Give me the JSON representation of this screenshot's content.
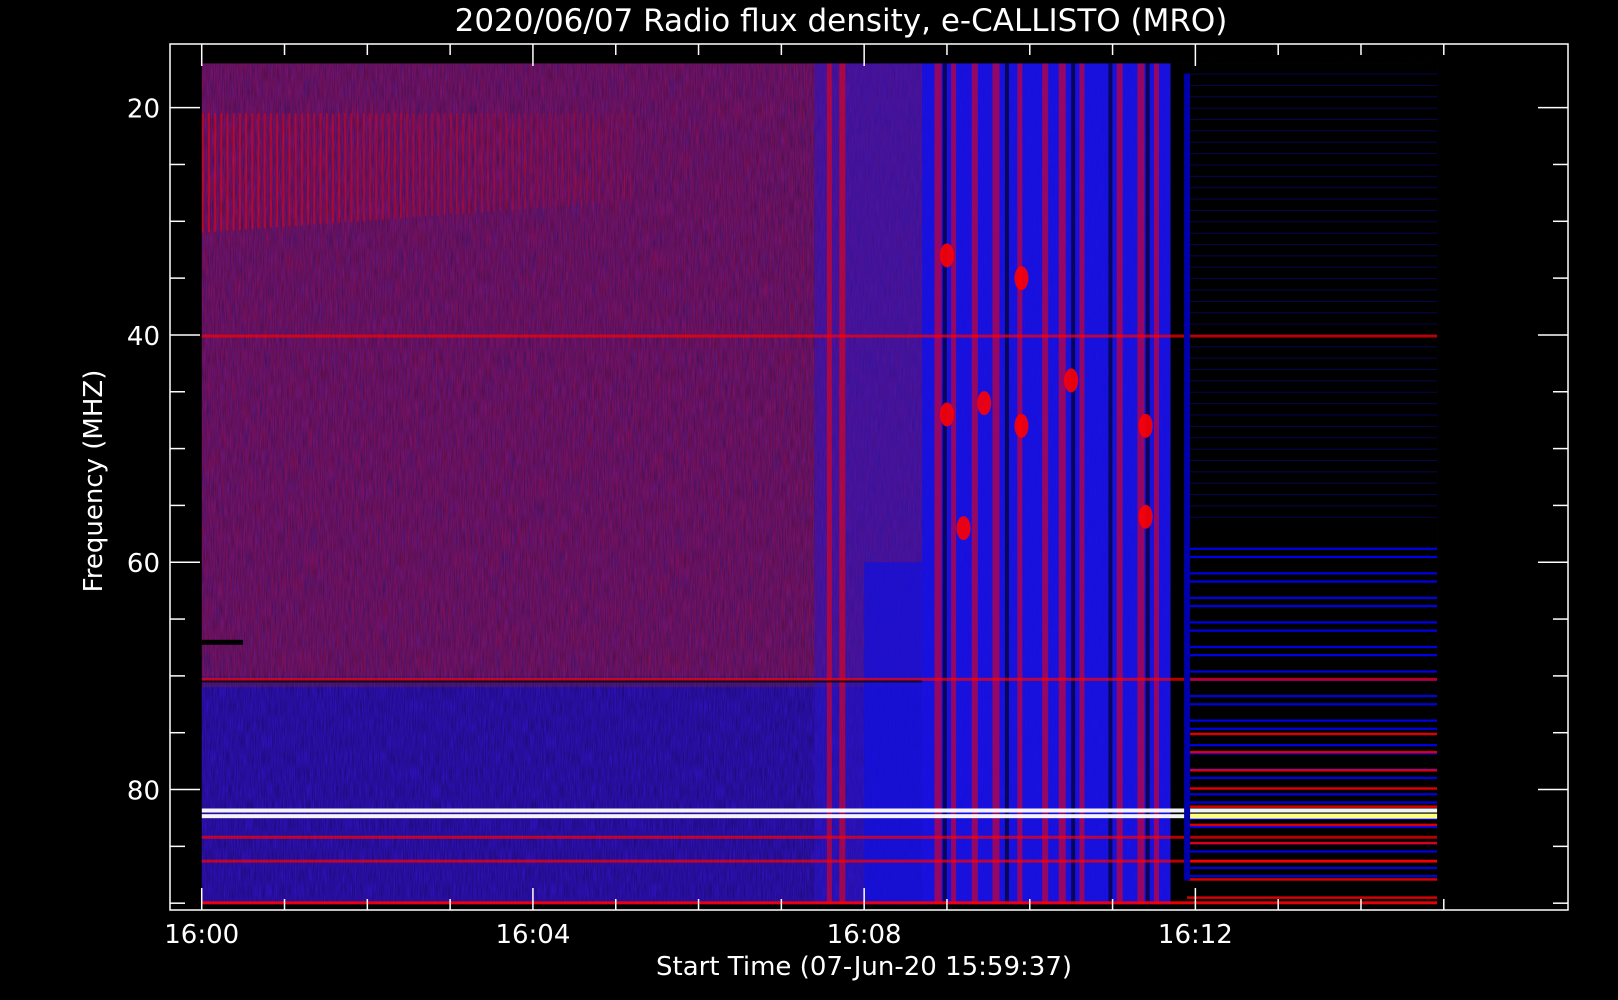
{
  "chart_data": {
    "type": "heatmap",
    "title": "2020/06/07  Radio flux density, e-CALLISTO (MRO)",
    "xlabel": "Start Time (07-Jun-20 15:59:37)",
    "ylabel": "Frequency (MHZ)",
    "x_range_minutes": [
      -0.383,
      16.5
    ],
    "y_range_mhz": [
      14.4,
      90.6
    ],
    "y_reversed": true,
    "x_ticks": [
      {
        "minute": 0,
        "label": "16:00"
      },
      {
        "minute": 4,
        "label": "16:04"
      },
      {
        "minute": 8,
        "label": "16:08"
      },
      {
        "minute": 12,
        "label": "16:12"
      }
    ],
    "x_minor_ticks_minutes": [
      1,
      2,
      3,
      5,
      6,
      7,
      9,
      10,
      11,
      13,
      14,
      15
    ],
    "y_ticks": [
      {
        "mhz": 20,
        "label": "20"
      },
      {
        "mhz": 40,
        "label": "40"
      },
      {
        "mhz": 60,
        "label": "60"
      },
      {
        "mhz": 80,
        "label": "80"
      }
    ],
    "y_minor_ticks_mhz": [
      25,
      30,
      35,
      45,
      50,
      55,
      65,
      70,
      75,
      85,
      90
    ],
    "data_extent": {
      "minute_start": 0,
      "minute_end": 14.92,
      "mhz_low": 16.1,
      "mhz_high": 90.1
    },
    "colormap": [
      "#000000",
      "#0000ff",
      "#7d1a8c",
      "#ff0000",
      "#ffff80",
      "#ffffff"
    ],
    "bands_mhz": [
      40.1,
      70.3,
      81.8,
      82.3,
      84.2,
      86.3
    ],
    "burst_start_minute": 8.7,
    "burst_end_minute": 11.7,
    "grid": false
  }
}
